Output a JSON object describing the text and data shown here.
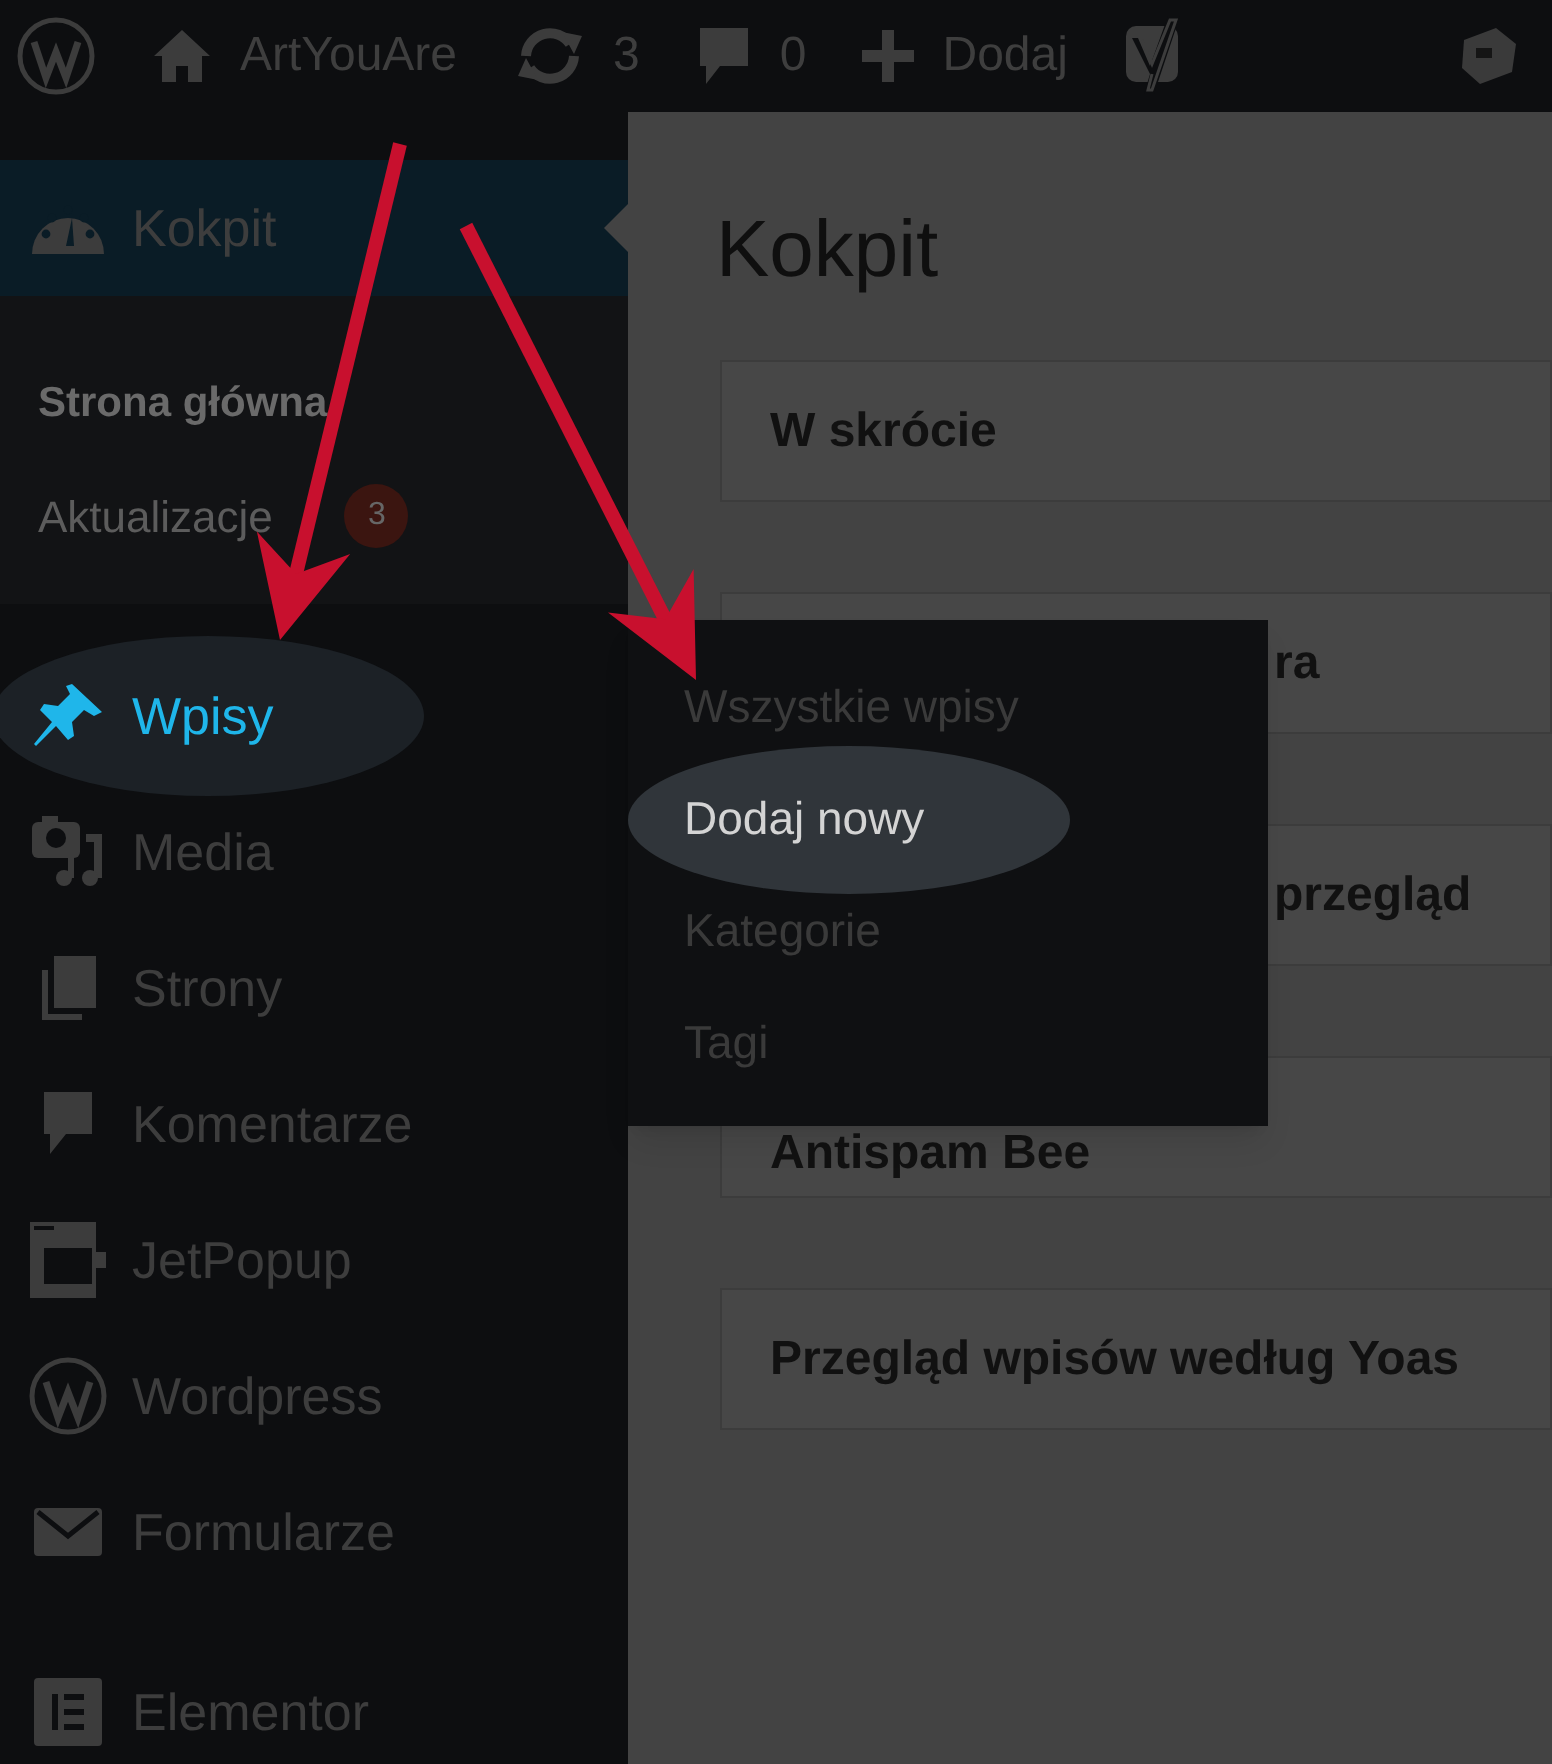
{
  "top_bar": {
    "items": [
      {
        "kind": "logo"
      },
      {
        "kind": "site",
        "label": "ArtYouAre"
      },
      {
        "kind": "updates",
        "label": "3"
      },
      {
        "kind": "comments",
        "label": "0"
      },
      {
        "kind": "new",
        "label": "Dodaj"
      },
      {
        "kind": "yoast"
      },
      {
        "kind": "avatar"
      }
    ]
  },
  "sidebar": {
    "items": [
      {
        "kind": "gauge",
        "label": "Kokpit",
        "selected": true,
        "highlighted": false,
        "children": [
          {
            "label": "Strona główna",
            "selected": true
          },
          {
            "label": "Aktualizacje",
            "selected": false,
            "badge": "3"
          }
        ]
      },
      {
        "kind": "pin",
        "label": "Wpisy",
        "selected": false,
        "highlighted": true
      },
      {
        "kind": "media",
        "label": "Media",
        "selected": false,
        "highlighted": false
      },
      {
        "kind": "pages",
        "label": "Strony",
        "selected": false,
        "highlighted": false
      },
      {
        "kind": "comment",
        "label": "Komentarze",
        "selected": false,
        "highlighted": false
      },
      {
        "kind": "popup",
        "label": "JetPopup",
        "selected": false,
        "highlighted": false
      },
      {
        "kind": "wp",
        "label": "Wordpress",
        "selected": false,
        "highlighted": false
      },
      {
        "kind": "mail",
        "label": "Formularze",
        "selected": false,
        "highlighted": false
      },
      {
        "kind": "elementor",
        "label": "Elementor",
        "selected": false,
        "highlighted": false,
        "separated": true
      }
    ]
  },
  "flyout": {
    "items": [
      {
        "label": "Wszystkie wpisy",
        "selected": false
      },
      {
        "label": "Dodaj nowy",
        "selected": true
      },
      {
        "label": "Kategorie",
        "selected": false
      },
      {
        "label": "Tagi",
        "selected": false
      }
    ]
  },
  "main": {
    "title": "Kokpit",
    "panels": [
      {
        "title": "W skrócie",
        "covered": false
      },
      {
        "title": "ra",
        "covered": true
      },
      {
        "title": "przegląd",
        "covered": true
      },
      {
        "title": "Antispam Bee",
        "covered": false
      },
      {
        "title": "Przegląd wpisów według Yoas",
        "covered": false
      }
    ]
  }
}
